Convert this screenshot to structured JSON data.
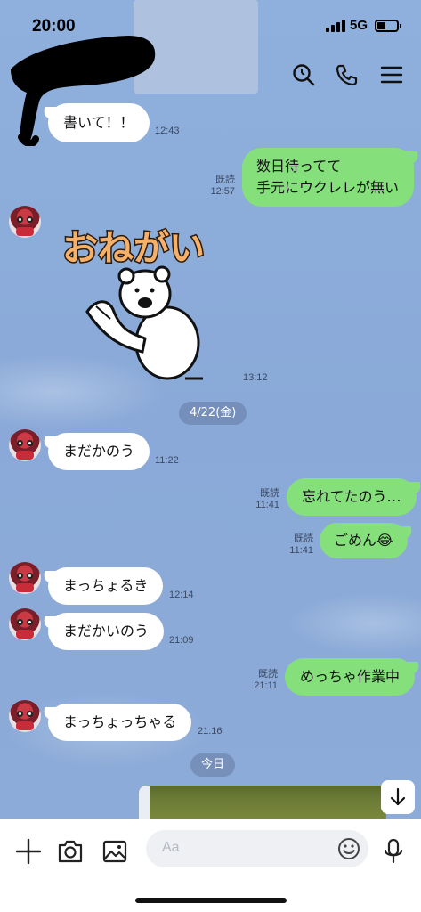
{
  "status_bar": {
    "time": "20:00",
    "network": "5G"
  },
  "header": {
    "icons": [
      "search-icon",
      "phone-icon",
      "menu-icon"
    ]
  },
  "messages": [
    {
      "side": "in",
      "text": "書いて！！",
      "time": "12:43"
    },
    {
      "side": "out",
      "text_lines": [
        "数日待ってて",
        "手元にウクレレが無い"
      ],
      "read": "既読",
      "time": "12:57"
    },
    {
      "side": "in",
      "type": "sticker",
      "sticker_text": "おねがい",
      "time": "13:12"
    },
    {
      "side": "in",
      "text": "まだかのう",
      "time": "11:22"
    },
    {
      "side": "out",
      "text": "忘れてたのう…",
      "read": "既読",
      "time": "11:41"
    },
    {
      "side": "out",
      "text": "ごめん😂",
      "read": "既読",
      "time": "11:41"
    },
    {
      "side": "in",
      "text": "まっちょるき",
      "time": "12:14"
    },
    {
      "side": "in",
      "text": "まだかいのう",
      "time": "21:09"
    },
    {
      "side": "out",
      "text": "めっちゃ作業中",
      "read": "既読",
      "time": "21:11"
    },
    {
      "side": "in",
      "text": "まっちょっちゃる",
      "time": "21:16"
    }
  ],
  "date_separators": [
    "4/22(金)",
    "今日"
  ],
  "input": {
    "placeholder": "Aa"
  },
  "colors": {
    "outgoing_bubble": "#85e07c",
    "incoming_bubble": "#ffffff",
    "chat_background": "#8cabd9"
  }
}
